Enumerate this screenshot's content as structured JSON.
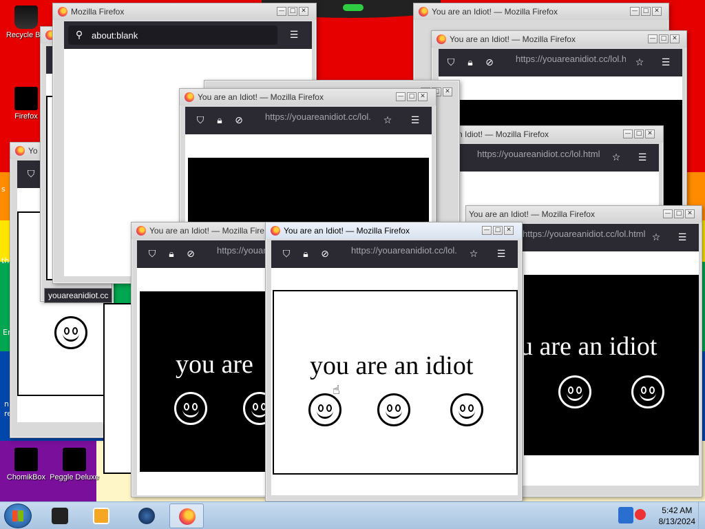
{
  "colors": {
    "wallpaper_bands": [
      "#e60000",
      "#e60000",
      "#ff8c00",
      "#ffe600",
      "#00a650",
      "#0047ab",
      "#7a0f9b"
    ],
    "toolbar": "#2b2a33",
    "url_field": "#1c1b22"
  },
  "desktop": {
    "icons": [
      {
        "label": "Recycle Bin",
        "icon": "recycle-bin-icon"
      },
      {
        "label": "Firefox",
        "icon": "firefox-icon"
      },
      {
        "label": "ChomikBox",
        "icon": "chomikbox-icon"
      },
      {
        "label": "Peggle Deluxe",
        "icon": "peggle-icon"
      }
    ],
    "edge_fragments": [
      "s",
      "th",
      "Er",
      "n",
      "re"
    ]
  },
  "windows": {
    "blank": {
      "title": "Mozilla Firefox",
      "url": "about:blank",
      "tooltip": "youareanidiot.cc"
    },
    "idiot_title": "You are an Idiot! — Mozilla Firefox",
    "partial_title": "n Idiot! — Mozilla Firefox",
    "partial_title_2": "Yo",
    "partial_title_3": "You are an Idiot! — Mozilla Fire",
    "url": "https://youareanidiot.cc/lol.html",
    "url_short": "https://youareanidiot.cc/lol.",
    "message": "you are an idiot",
    "message_partial": "you are",
    "message_right": "u are an idiot"
  },
  "window_controls": {
    "minimize": "—",
    "maximize": "□",
    "close": "✕"
  },
  "toolbar_icons": [
    "search-icon",
    "shield-icon",
    "lock-icon",
    "permissions-icon",
    "bookmark-star-icon",
    "menu-icon"
  ],
  "taskbar": {
    "items": [
      {
        "icon": "windows-start-icon"
      },
      {
        "icon": "terminal-app-icon"
      },
      {
        "icon": "media-player-icon"
      },
      {
        "icon": "globe-app-icon"
      },
      {
        "icon": "firefox-icon",
        "active": true
      }
    ],
    "clock_time": "5:42 AM",
    "clock_date": "8/13/2024"
  }
}
